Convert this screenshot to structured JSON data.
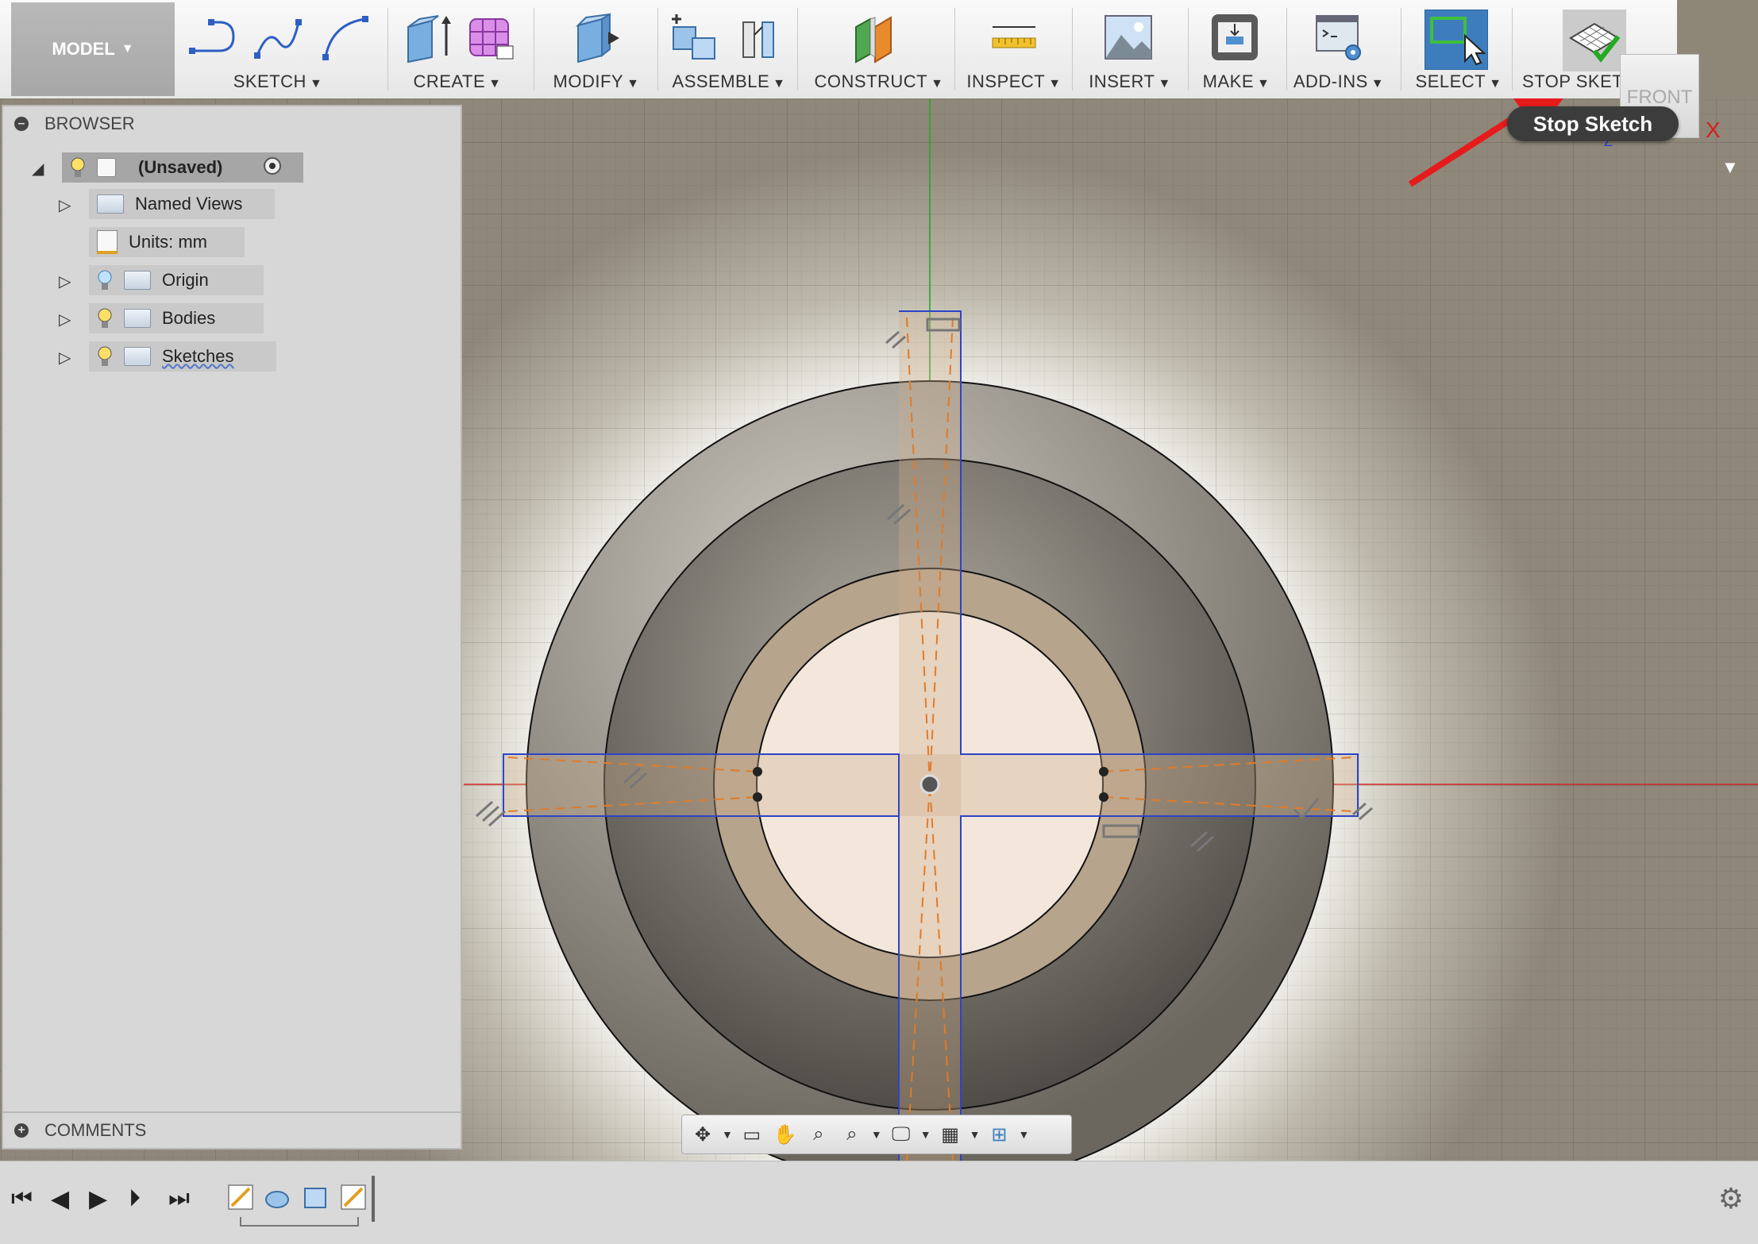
{
  "toolbar": {
    "model_label": "MODEL",
    "groups": [
      {
        "key": "sketch",
        "label": "SKETCH"
      },
      {
        "key": "create",
        "label": "CREATE"
      },
      {
        "key": "modify",
        "label": "MODIFY"
      },
      {
        "key": "assemble",
        "label": "ASSEMBLE"
      },
      {
        "key": "construct",
        "label": "CONSTRUCT"
      },
      {
        "key": "inspect",
        "label": "INSPECT"
      },
      {
        "key": "insert",
        "label": "INSERT"
      },
      {
        "key": "make",
        "label": "MAKE"
      },
      {
        "key": "addins",
        "label": "ADD-INS"
      },
      {
        "key": "select",
        "label": "SELECT"
      },
      {
        "key": "stop",
        "label": "STOP SKETCH"
      }
    ]
  },
  "tooltip": {
    "text": "Stop Sketch"
  },
  "viewcube": {
    "face": "FRONT",
    "axis_x": "X",
    "axis_z": "Z"
  },
  "browser": {
    "title": "BROWSER",
    "root": "(Unsaved)",
    "items": [
      {
        "label": "Named Views"
      },
      {
        "label": "Units: mm"
      },
      {
        "label": "Origin"
      },
      {
        "label": "Bodies"
      },
      {
        "label": "Sketches"
      }
    ]
  },
  "comments": {
    "title": "COMMENTS"
  },
  "colors": {
    "toolbar_bg": "#ececec",
    "select_active": "#3d7dbd",
    "sketch_line": "#2c44c8",
    "constraint_line": "#e07b2a",
    "x_axis": "#d42020",
    "y_axis": "#29a329",
    "annotation_arrow": "#e61b1b"
  }
}
